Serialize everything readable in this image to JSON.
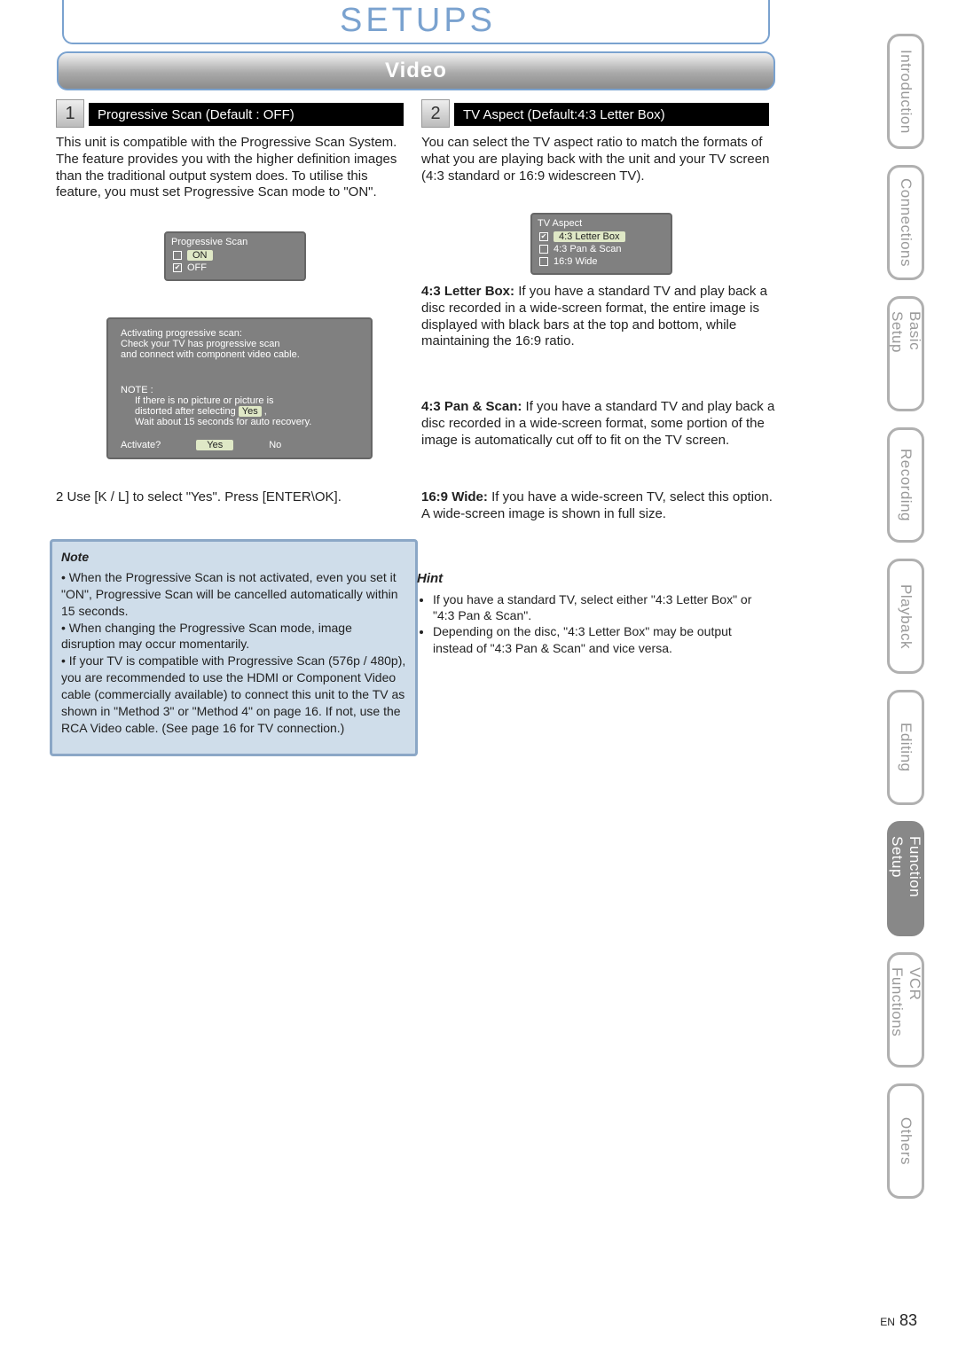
{
  "title": "SETUPS",
  "banner": "Video",
  "side_tabs": [
    {
      "label": "Introduction",
      "active": false
    },
    {
      "label": "Connections",
      "active": false
    },
    {
      "label": "Basic Setup",
      "active": false
    },
    {
      "label": "Recording",
      "active": false
    },
    {
      "label": "Playback",
      "active": false
    },
    {
      "label": "Editing",
      "active": false
    },
    {
      "label": "Function Setup",
      "active": true
    },
    {
      "label": "VCR Functions",
      "active": false
    },
    {
      "label": "Others",
      "active": false
    }
  ],
  "section1": {
    "num": "1",
    "title": "Progressive Scan (Default : OFF)",
    "body": "This unit is compatible with the Progressive Scan System. The feature provides you with the higher definition images than the traditional output system does. To utilise this feature, you must set Progressive Scan mode to \"ON\".",
    "option_window": {
      "header": "Progressive Scan",
      "rows": [
        {
          "label": "ON",
          "checked": false,
          "selected": true
        },
        {
          "label": "OFF",
          "checked": true,
          "selected": false
        }
      ]
    },
    "dialog": {
      "lines": "Activating progressive scan:\nCheck your TV has progressive scan\nand connect with component video cable.",
      "note_title": "NOTE :",
      "note_lines": "If there is no picture or picture is\ndistorted after selecting \"Yes\",\nWait about 15 seconds for auto recovery.",
      "yes_inline": "Yes",
      "prompt": "Activate?",
      "yes": "Yes",
      "no": "No"
    },
    "after_dialog": "2 Use [K / L] to select \"Yes\". Press [ENTER\\OK].",
    "note_box": {
      "heading": "Note",
      "body": "• When the Progressive Scan is not activated, even you set it \"ON\", Progressive Scan will be cancelled automatically within 15 seconds.\n• When changing the Progressive Scan mode, image disruption may occur momentarily.\n• If your TV is compatible with Progressive Scan (576p / 480p), you are recommended to use the HDMI or Component Video cable (commercially available) to connect this unit to the TV as shown in \"Method 3\" or \"Method 4\" on page 16. If not, use the RCA Video cable. (See page 16 for TV connection.)"
    }
  },
  "section2": {
    "num": "2",
    "title": "TV Aspect (Default:4:3 Letter Box)",
    "body": "You can select the TV aspect ratio to match the formats of what you are playing back with the unit and your TV screen (4:3 standard or 16:9 widescreen TV).",
    "option_window": {
      "header": "TV Aspect",
      "rows": [
        {
          "label": "4:3 Letter Box",
          "checked": true,
          "selected": true
        },
        {
          "label": "4:3 Pan & Scan",
          "checked": false,
          "selected": false
        },
        {
          "label": "16:9 Wide",
          "checked": false,
          "selected": false
        }
      ]
    },
    "descriptions": [
      {
        "lead": "4:3 Letter Box:",
        "body": "If you have a standard TV and play back a disc recorded in a wide-screen format, the entire image is displayed with black bars at the top and bottom, while maintaining the 16:9 ratio."
      },
      {
        "lead": "4:3 Pan & Scan:",
        "body": "If you have a standard TV and play back a disc recorded in a wide-screen format, some portion of the image is automatically cut off to fit on the TV screen."
      },
      {
        "lead": "16:9 Wide:",
        "body": "If you have a wide-screen TV, select this option. A wide-screen image is shown in full size."
      }
    ],
    "hint": {
      "title": "Hint",
      "items": [
        "If you have a standard TV, select either \"4:3 Letter Box\" or \"4:3 Pan & Scan\".",
        "Depending on the disc, \"4:3 Letter Box\" may be output instead of \"4:3 Pan & Scan\" and vice versa."
      ]
    }
  },
  "page": {
    "num": "83",
    "region": "EN"
  }
}
